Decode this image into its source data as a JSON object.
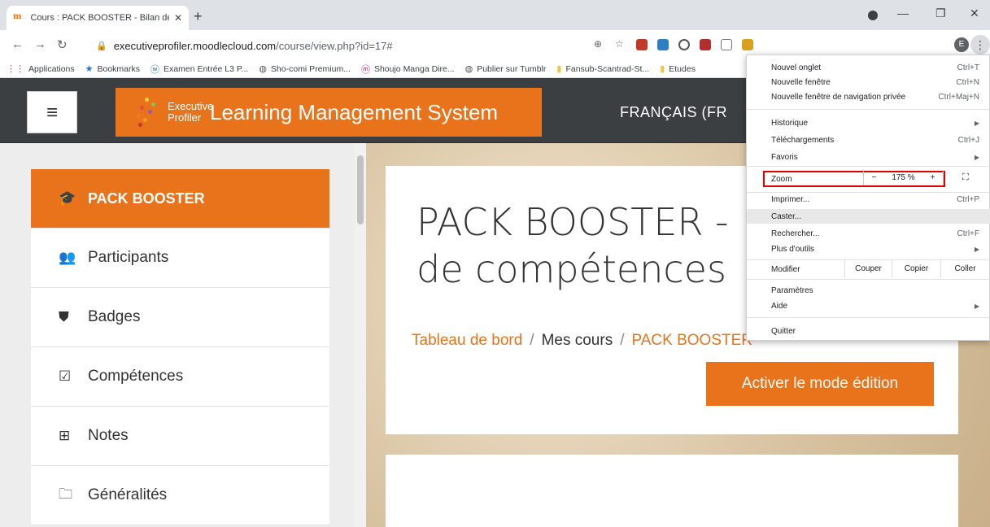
{
  "browser": {
    "tab_title": "Cours : PACK BOOSTER - Bilan de",
    "tab_close": "✕",
    "new_tab": "+",
    "url_host": "executiveprofiler.moodlecloud.com",
    "url_path": "/course/view.php?id=17#",
    "avatar_letter": "E",
    "bookmarks": [
      {
        "icon": "apps-grid-icon",
        "glyph": "⋮⋮",
        "label": "Applications"
      },
      {
        "icon": "star-icon",
        "glyph": "★",
        "label": "Bookmarks"
      },
      {
        "icon": "wordpress-icon",
        "glyph": "ⓦ",
        "label": "Examen Entrée L3 P..."
      },
      {
        "icon": "globe-icon",
        "glyph": "◍",
        "label": "Sho-comi Premium..."
      },
      {
        "icon": "manga-icon",
        "glyph": "ⓜ",
        "label": "Shoujo Manga Dire..."
      },
      {
        "icon": "globe-icon",
        "glyph": "◍",
        "label": "Publier sur Tumblr"
      },
      {
        "icon": "folder-icon",
        "glyph": "▮",
        "label": "Fansub-Scantrad-St..."
      },
      {
        "icon": "folder-icon",
        "glyph": "▮",
        "label": "Etudes"
      }
    ]
  },
  "site": {
    "hamburger": "≡",
    "brand_sub": "Executive Profiler",
    "brand_title": "Learning Management System",
    "language": "FRANÇAIS (FR"
  },
  "drawer": [
    {
      "icon": "graduation-cap-icon",
      "glyph": "🎓",
      "label": "PACK BOOSTER",
      "active": true
    },
    {
      "icon": "users-icon",
      "glyph": "👥",
      "label": "Participants"
    },
    {
      "icon": "shield-icon",
      "glyph": "⛊",
      "label": "Badges"
    },
    {
      "icon": "checkbox-icon",
      "glyph": "☑",
      "label": "Compétences"
    },
    {
      "icon": "table-icon",
      "glyph": "⊞",
      "label": "Notes"
    },
    {
      "icon": "folder-outline-icon",
      "glyph": "🗀",
      "label": "Généralités"
    }
  ],
  "course": {
    "title_line1": "PACK BOOSTER -",
    "title_line2": "de compétences",
    "breadcrumb": [
      "Tableau de bord",
      "Mes cours",
      "PACK BOOSTER"
    ],
    "breadcrumb_sep": "/",
    "edit_button": "Activer le mode édition"
  },
  "menu": {
    "new_tab": "Nouvel onglet",
    "new_tab_sc": "Ctrl+T",
    "new_window": "Nouvelle fenêtre",
    "new_window_sc": "Ctrl+N",
    "incognito": "Nouvelle fenêtre de navigation privée",
    "incognito_sc": "Ctrl+Maj+N",
    "history": "Historique",
    "downloads": "Téléchargements",
    "downloads_sc": "Ctrl+J",
    "favorites": "Favoris",
    "zoom": "Zoom",
    "zoom_minus": "−",
    "zoom_value": "175 %",
    "zoom_plus": "+",
    "print": "Imprimer...",
    "print_sc": "Ctrl+P",
    "cast": "Caster...",
    "search": "Rechercher...",
    "search_sc": "Ctrl+F",
    "more_tools": "Plus d'outils",
    "edit": "Modifier",
    "cut": "Couper",
    "copy": "Copier",
    "paste": "Coller",
    "settings": "Paramètres",
    "help": "Aide",
    "quit": "Quitter"
  },
  "colors": {
    "accent": "#e8731b",
    "navbar": "#3c3f41",
    "highlight_box": "#e00000"
  }
}
